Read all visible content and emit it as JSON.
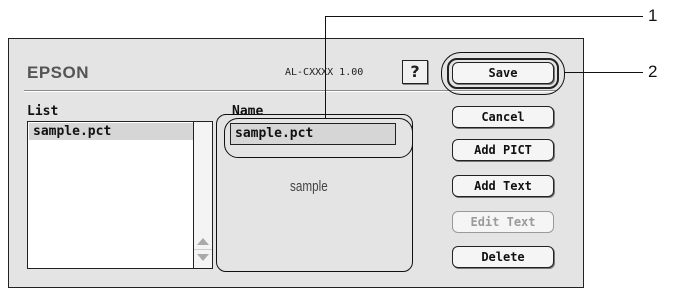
{
  "dialog": {
    "brand": "EPSON",
    "model": "AL-CXXXX 1.00",
    "help_label": "?"
  },
  "list": {
    "label": "List",
    "items": [
      "sample.pct"
    ]
  },
  "name": {
    "label": "Name",
    "value": "sample.pct"
  },
  "preview": {
    "text": "sample"
  },
  "buttons": {
    "save": "Save",
    "cancel": "Cancel",
    "add_pict": "Add PICT",
    "add_text": "Add Text",
    "edit_text": "Edit Text",
    "delete": "Delete"
  },
  "callouts": {
    "one": "1",
    "two": "2"
  },
  "icons": {
    "scroll_up": "up-arrow-icon",
    "scroll_down": "down-arrow-icon"
  }
}
